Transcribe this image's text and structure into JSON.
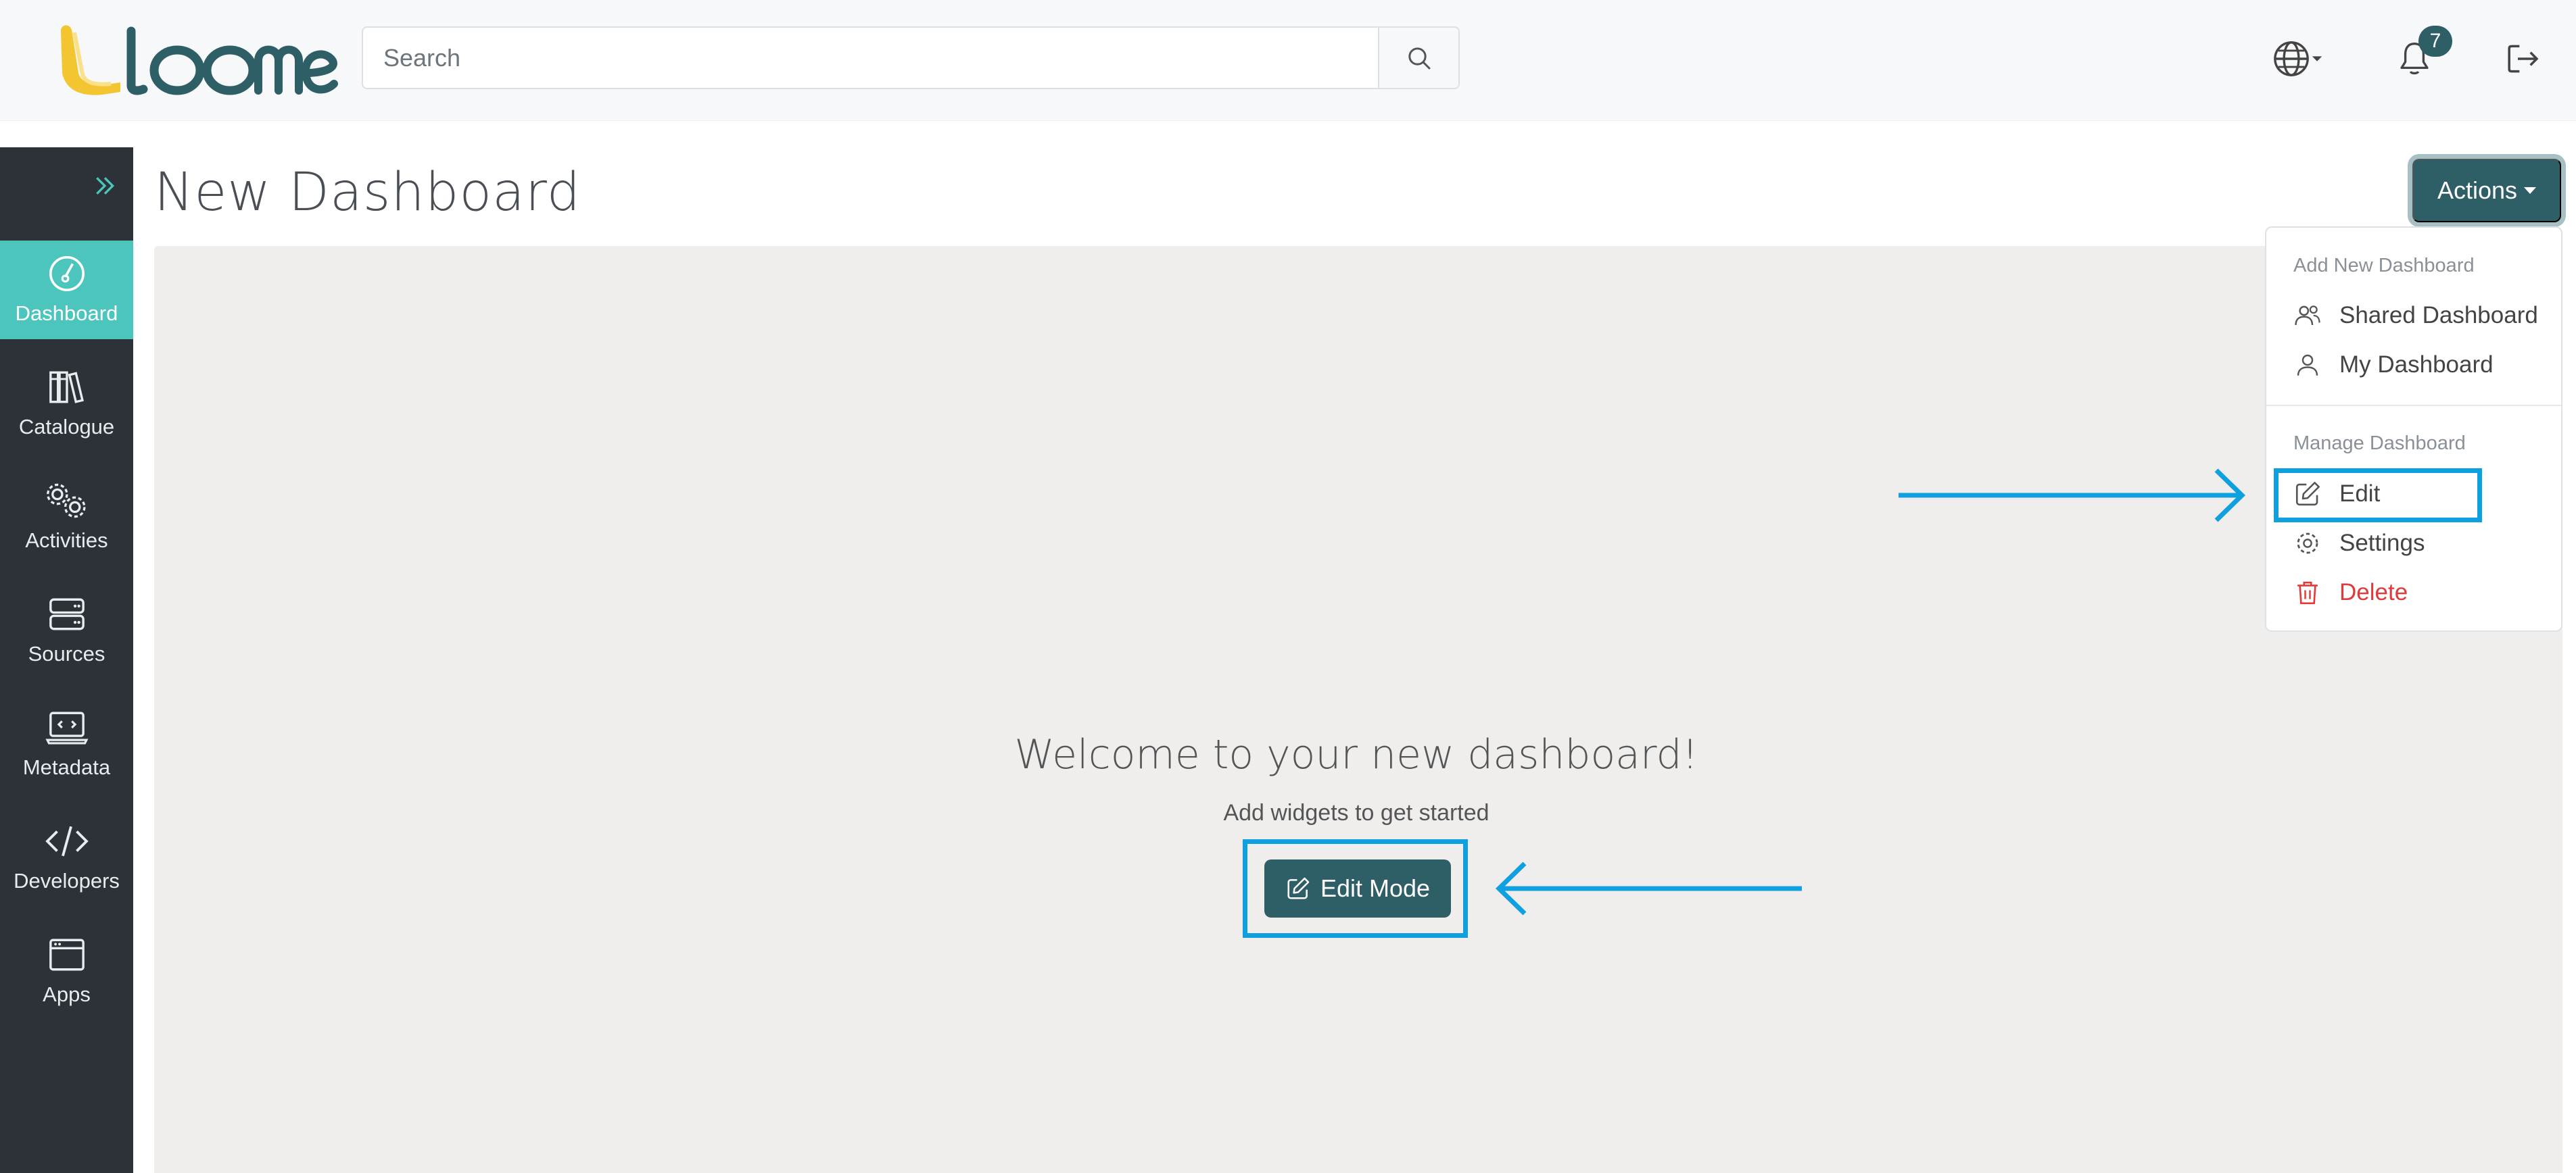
{
  "header": {
    "logo_text": "Loome",
    "search_placeholder": "Search",
    "notification_count": "7",
    "icons": {
      "search": "search-icon",
      "language": "globe-icon",
      "notifications": "bell-icon",
      "logout": "logout-icon"
    }
  },
  "sidebar": {
    "items": [
      {
        "label": "Dashboard",
        "icon": "dashboard-gauge-icon",
        "active": true
      },
      {
        "label": "Catalogue",
        "icon": "books-icon"
      },
      {
        "label": "Activities",
        "icon": "gears-icon"
      },
      {
        "label": "Sources",
        "icon": "server-icon"
      },
      {
        "label": "Metadata",
        "icon": "code-monitor-icon"
      },
      {
        "label": "Developers",
        "icon": "code-brackets-icon"
      },
      {
        "label": "Apps",
        "icon": "app-window-icon"
      }
    ]
  },
  "main": {
    "title": "New Dashboard",
    "welcome_title": "Welcome to your new dashboard!",
    "welcome_subtitle": "Add widgets to get started",
    "edit_mode_label": "Edit Mode"
  },
  "actions": {
    "label": "Actions",
    "menu": {
      "add_header": "Add New Dashboard",
      "shared_dashboard": "Shared Dashboard",
      "my_dashboard": "My Dashboard",
      "manage_header": "Manage Dashboard",
      "edit": "Edit",
      "settings": "Settings",
      "delete": "Delete"
    }
  },
  "colors": {
    "accent": "#2f5f66",
    "active_nav": "#4cc5bd",
    "sidebar_bg": "#2d3138",
    "highlight": "#0fa0e0",
    "danger": "#e13a3a"
  }
}
